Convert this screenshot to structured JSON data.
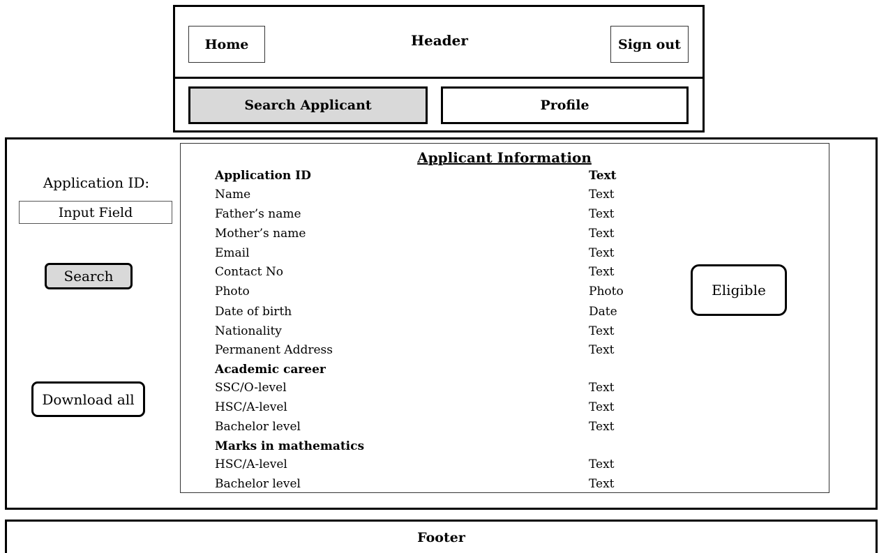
{
  "header": {
    "title": "Header",
    "home_label": "Home",
    "signout_label": "Sign out"
  },
  "tabs": [
    {
      "label": "Search Applicant",
      "active": true
    },
    {
      "label": "Profile",
      "active": false
    }
  ],
  "sidebar": {
    "appid_label": "Application ID:",
    "input_placeholder": "Input Field",
    "search_label": "Search",
    "download_label": "Download all"
  },
  "info": {
    "title": "Applicant Information",
    "rows": [
      {
        "label": "Application ID",
        "value": "Text"
      },
      {
        "label": "Name",
        "value": "Text"
      },
      {
        "label": "Father’s name",
        "value": "Text"
      },
      {
        "label": "Mother’s name",
        "value": "Text"
      },
      {
        "label": "Email",
        "value": "Text"
      },
      {
        "label": "Contact No",
        "value": "Text"
      },
      {
        "label": "Photo",
        "value": "Photo"
      },
      {
        "label": "Date of birth",
        "value": "Date"
      },
      {
        "label": "Nationality",
        "value": "Text"
      },
      {
        "label": "Permanent Address",
        "value": "Text"
      },
      {
        "label": "Academic career",
        "value": ""
      },
      {
        "label": "SSC/O-level",
        "value": "Text"
      },
      {
        "label": "HSC/A-level",
        "value": "Text"
      },
      {
        "label": "Bachelor level",
        "value": "Text"
      },
      {
        "label": "Marks in mathematics",
        "value": ""
      },
      {
        "label": "HSC/A-level",
        "value": "Text"
      },
      {
        "label": "Bachelor level",
        "value": "Text"
      }
    ]
  },
  "eligible_label": "Eligible",
  "footer": {
    "label": "Footer"
  },
  "colors": {
    "active_tab_bg": "#d9d9d9",
    "search_button_bg": "#d9d9d9",
    "border": "#000000"
  }
}
